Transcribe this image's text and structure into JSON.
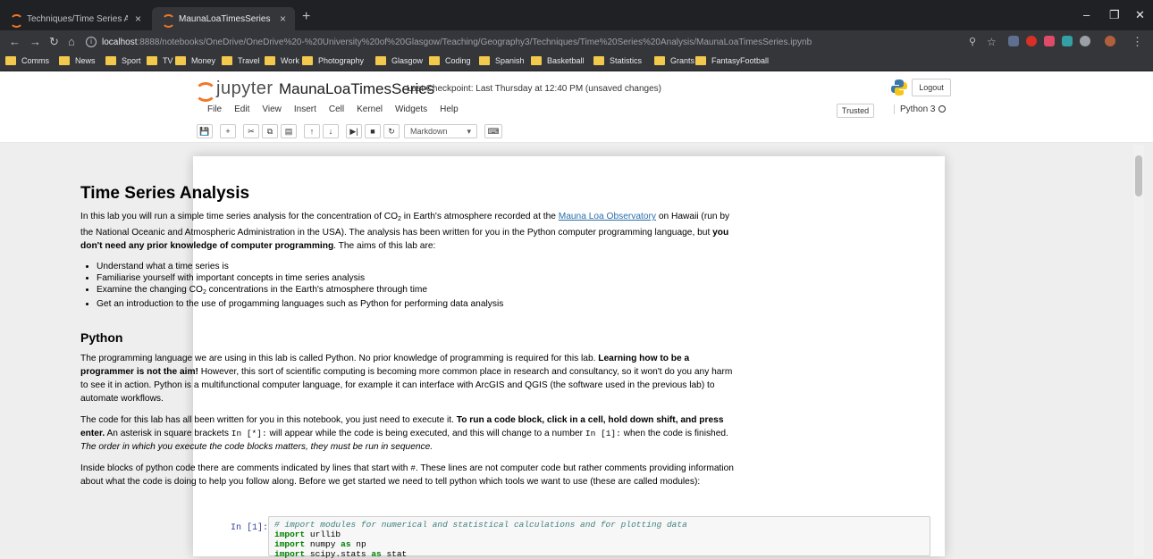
{
  "browser": {
    "tabs": [
      {
        "title": "Techniques/Time Series Analysis/",
        "close": "×"
      },
      {
        "title": "MaunaLoaTimesSeries",
        "close": "×"
      }
    ],
    "new_tab": "+",
    "window": {
      "minimize": "–",
      "restore": "❐",
      "close": "✕"
    },
    "address": {
      "host": "localhost",
      "path": ":8888/notebooks/OneDrive/OneDrive%20-%20University%20of%20Glasgow/Teaching/Geography3/Techniques/Time%20Series%20Analysis/MaunaLoaTimesSeries.ipynb"
    },
    "bookmarks": [
      "Comms",
      "News",
      "Sport",
      "TV",
      "Money",
      "Travel",
      "Work",
      "Photography",
      "Glasgow",
      "Coding",
      "Spanish",
      "Basketball",
      "Statistics",
      "Grants",
      "FantasyFootball"
    ]
  },
  "jupyter": {
    "logo_text": "jupyter",
    "notebook_name": "MaunaLoaTimesSeries",
    "checkpoint": "Last Checkpoint: Last Thursday at 12:40 PM (unsaved changes)",
    "logout": "Logout",
    "menus": [
      "File",
      "Edit",
      "View",
      "Insert",
      "Cell",
      "Kernel",
      "Widgets",
      "Help"
    ],
    "trusted": "Trusted",
    "kernel": "Python 3",
    "cell_type": "Markdown",
    "toolbar_icons": [
      "save-icon",
      "plus-icon",
      "cut-icon",
      "copy-icon",
      "paste-icon",
      "arrow-up-icon",
      "arrow-down-icon",
      "run-icon",
      "stop-icon",
      "restart-icon",
      "keyboard-icon"
    ]
  },
  "notebook": {
    "title": "Time Series Analysis",
    "intro": {
      "pre_co2": "In this lab you will run a simple time series analysis for the concentration of CO",
      "sub2": "2",
      "pre_link": " in Earth's atmosphere recorded at the ",
      "link": "Mauna Loa Observatory",
      "post_link": " on Hawaii (run by the National Oceanic and Atmospheric Administration in the USA). The analysis has been written for you in the Python computer programming language, but ",
      "bold": "you don't need any prior knowledge of computer programming",
      "end": ". The aims of this lab are:"
    },
    "aims": {
      "a1": "Understand what a time series is",
      "a2": "Familiarise yourself with important concepts in time series analysis",
      "a3_pre": "Examine the changing CO",
      "a3_sub": "2",
      "a3_post": " concentrations in the Earth's atmosphere through time",
      "a4": "Get an introduction to the use of progamming languages such as Python for performing data analysis"
    },
    "python_heading": "Python",
    "p1": {
      "t1": "The programming language we are using in this lab is called Python. No prior knowledge of programming is required for this lab. ",
      "b1": "Learning how to be a programmer is not the aim!",
      "t2": " However, this sort of scientific computing is becoming more common place in research and consultancy, so it won't do you any harm to see it in action. Python is a multifunctional computer language, for example it can interface with ArcGIS and QGIS (the software used in the previous lab) to automate workflows."
    },
    "p2": {
      "t1": "The code for this lab has all been written for you in this notebook, you just need to execute it. ",
      "b1": "To run a code block, click in a cell, hold down shift, and press enter.",
      "t2": " An asterisk in square brackets ",
      "c1": "In [*]:",
      "t3": " will appear while the code is being executed, and this will change to a number ",
      "c2": "In [1]:",
      "t4": " when the code is finished. ",
      "i1": "The order in which you execute the code blocks matters, they must be run in sequence."
    },
    "p3": {
      "t1": "Inside blocks of python code there are comments indicated by lines that start with ",
      "c1": "#",
      "t2": ". These lines are not computer code but rather comments providing information about what the code is doing to help you follow along. Before we get started we need to tell python which tools we want to use (these are called modules):"
    },
    "code_prompt": "In [1]:",
    "code": {
      "comment": "# import modules for numerical and statistical calculations and for plotting data",
      "l2_kw": "import",
      "l2_mod": " urllib",
      "l3_kw": "import",
      "l3_mod": " numpy ",
      "l3_as": "as",
      "l3_alias": " np",
      "l4_kw": "import",
      "l4_mod": " scipy.stats ",
      "l4_as": "as",
      "l4_alias": " stat"
    }
  }
}
